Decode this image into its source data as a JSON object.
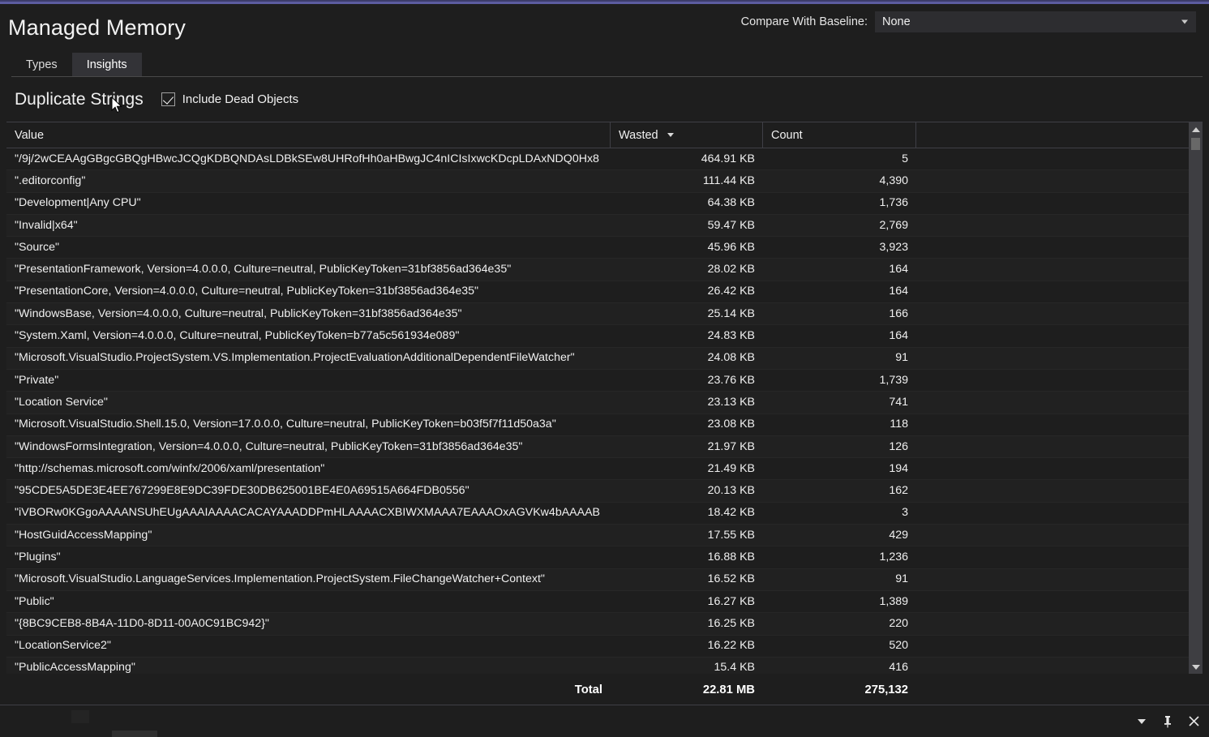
{
  "theme": {
    "accent": "#5c5ca0",
    "background": "#1e1e1e",
    "row_alt": "#212121",
    "grid_line": "#3f3f46",
    "text": "#f0f0f0",
    "scrollbar": "#3e3e42"
  },
  "header": {
    "title": "Managed Memory",
    "baseline_label": "Compare With Baseline:",
    "baseline_value": "None",
    "baseline_options": [
      "None"
    ]
  },
  "tabs": [
    {
      "label": "Types",
      "active": false
    },
    {
      "label": "Insights",
      "active": true
    }
  ],
  "toolbar": {
    "section_title": "Duplicate Strings",
    "include_dead_objects_label": "Include Dead Objects",
    "include_dead_objects_checked": true
  },
  "grid": {
    "columns": [
      {
        "key": "value",
        "label": "Value",
        "sorted": false,
        "sort_dir": ""
      },
      {
        "key": "wasted",
        "label": "Wasted",
        "sorted": true,
        "sort_dir": "desc"
      },
      {
        "key": "count",
        "label": "Count",
        "sorted": false,
        "sort_dir": ""
      },
      {
        "key": "filler",
        "label": "",
        "sorted": false,
        "sort_dir": ""
      }
    ],
    "rows": [
      {
        "value": "\"/9j/2wCEAAgGBgcGBQgHBwcJCQgKDBQNDAsLDBkSEw8UHRofHh0aHBwgJC4nICIsIxwcKDcpLDAxNDQ0Hx8​",
        "wasted": "464.91 KB",
        "count": "5"
      },
      {
        "value": "\".editorconfig\"",
        "wasted": "111.44 KB",
        "count": "4,390"
      },
      {
        "value": "\"Development|Any CPU\"",
        "wasted": "64.38 KB",
        "count": "1,736"
      },
      {
        "value": "\"Invalid|x64\"",
        "wasted": "59.47 KB",
        "count": "2,769"
      },
      {
        "value": "\"Source\"",
        "wasted": "45.96 KB",
        "count": "3,923"
      },
      {
        "value": "\"PresentationFramework, Version=4.0.0.0, Culture=neutral, PublicKeyToken=31bf3856ad364e35\"",
        "wasted": "28.02 KB",
        "count": "164"
      },
      {
        "value": "\"PresentationCore, Version=4.0.0.0, Culture=neutral, PublicKeyToken=31bf3856ad364e35\"",
        "wasted": "26.42 KB",
        "count": "164"
      },
      {
        "value": "\"WindowsBase, Version=4.0.0.0, Culture=neutral, PublicKeyToken=31bf3856ad364e35\"",
        "wasted": "25.14 KB",
        "count": "166"
      },
      {
        "value": "\"System.Xaml, Version=4.0.0.0, Culture=neutral, PublicKeyToken=b77a5c561934e089\"",
        "wasted": "24.83 KB",
        "count": "164"
      },
      {
        "value": "\"Microsoft.VisualStudio.ProjectSystem.VS.Implementation.ProjectEvaluationAdditionalDependentFileWatcher\"",
        "wasted": "24.08 KB",
        "count": "91"
      },
      {
        "value": "\"Private\"",
        "wasted": "23.76 KB",
        "count": "1,739"
      },
      {
        "value": "\"Location Service\"",
        "wasted": "23.13 KB",
        "count": "741"
      },
      {
        "value": "\"Microsoft.VisualStudio.Shell.15.0, Version=17.0.0.0, Culture=neutral, PublicKeyToken=b03f5f7f11d50a3a\"",
        "wasted": "23.08 KB",
        "count": "118"
      },
      {
        "value": "\"WindowsFormsIntegration, Version=4.0.0.0, Culture=neutral, PublicKeyToken=31bf3856ad364e35\"",
        "wasted": "21.97 KB",
        "count": "126"
      },
      {
        "value": "\"http://schemas.microsoft.com/winfx/2006/xaml/presentation\"",
        "wasted": "21.49 KB",
        "count": "194"
      },
      {
        "value": "\"95CDE5A5DE3E4EE767299E8E9DC39FDE30DB625001BE4E0A69515A664FDB0556\"",
        "wasted": "20.13 KB",
        "count": "162"
      },
      {
        "value": "\"iVBORw0KGgoAAAANSUhEUgAAAIAAAACACAYAAADDPmHLAAAACXBIWXMAAA7EAAAOxAGVKw4bAAAAB​",
        "wasted": "18.42 KB",
        "count": "3"
      },
      {
        "value": "\"HostGuidAccessMapping\"",
        "wasted": "17.55 KB",
        "count": "429"
      },
      {
        "value": "\"Plugins\"",
        "wasted": "16.88 KB",
        "count": "1,236"
      },
      {
        "value": "\"Microsoft.VisualStudio.LanguageServices.Implementation.ProjectSystem.FileChangeWatcher+Context\"",
        "wasted": "16.52 KB",
        "count": "91"
      },
      {
        "value": "\"Public\"",
        "wasted": "16.27 KB",
        "count": "1,389"
      },
      {
        "value": "\"{8BC9CEB8-8B4A-11D0-8D11-00A0C91BC942}\"",
        "wasted": "16.25 KB",
        "count": "220"
      },
      {
        "value": "\"LocationService2\"",
        "wasted": "16.22 KB",
        "count": "520"
      },
      {
        "value": "\"PublicAccessMapping\"",
        "wasted": "15.4 KB",
        "count": "416"
      }
    ],
    "total": {
      "label": "Total",
      "wasted": "22.81 MB",
      "count": "275,132"
    }
  },
  "statusbar": {
    "icons": [
      "chevron-down-icon",
      "pin-icon",
      "close-icon"
    ]
  }
}
